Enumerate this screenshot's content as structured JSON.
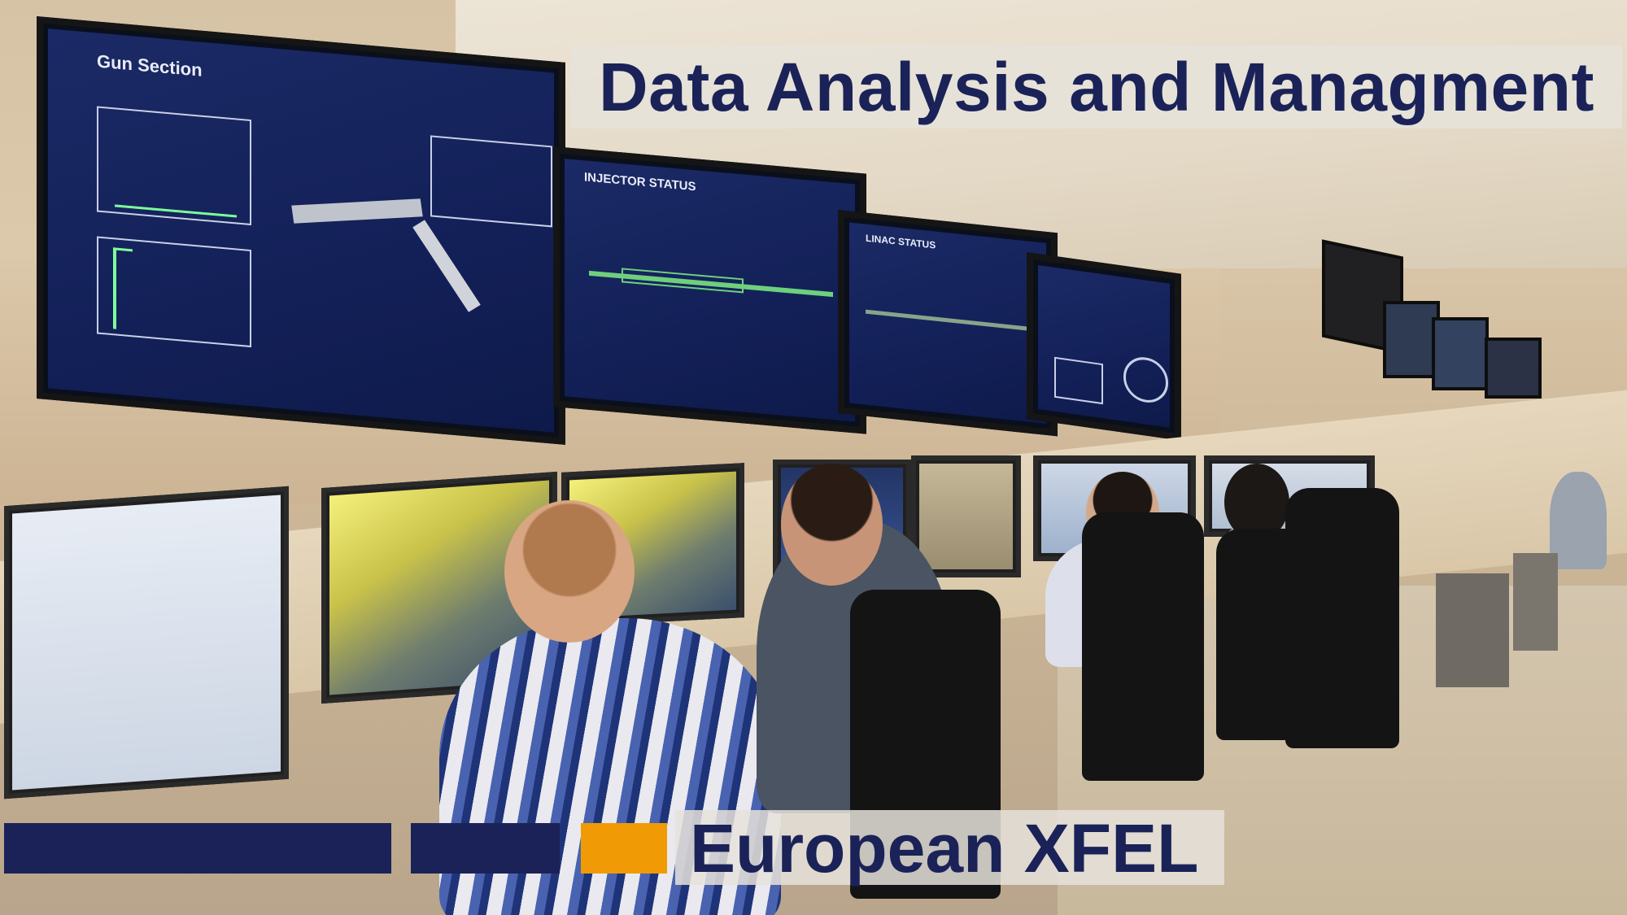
{
  "title": "Data Analysis and Managment",
  "brand": {
    "name": "European XFEL",
    "colors": {
      "navy": "#1a2258",
      "orange": "#f09b06"
    }
  },
  "scene": {
    "wall_screens": [
      {
        "title": "Gun Section"
      },
      {
        "title": "INJECTOR STATUS"
      },
      {
        "title": "LINAC STATUS"
      },
      {
        "title": ""
      }
    ]
  }
}
